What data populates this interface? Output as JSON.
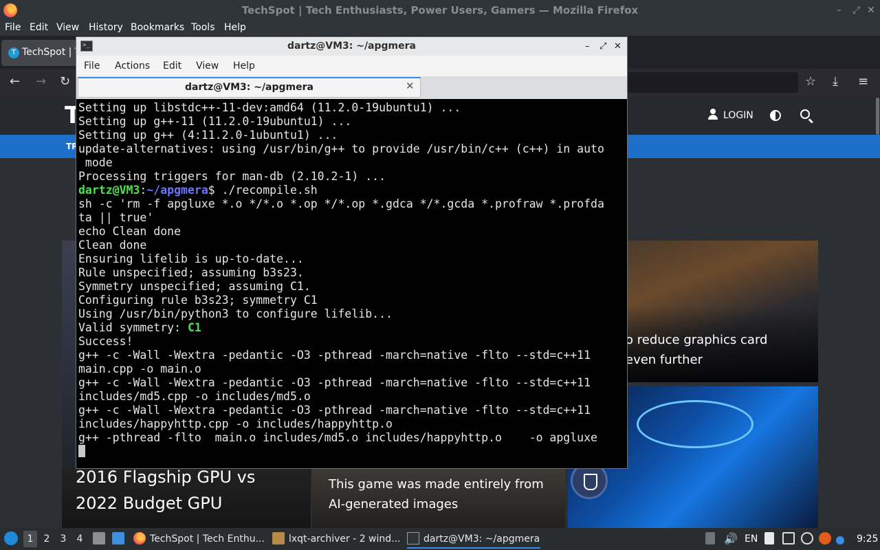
{
  "firefox": {
    "window_title": "TechSpot | Tech Enthusiasts, Power Users, Gamers — Mozilla Firefox",
    "menu": [
      {
        "label": "File"
      },
      {
        "label": "Edit"
      },
      {
        "label": "View"
      },
      {
        "label": "History"
      },
      {
        "label": "Bookmarks"
      },
      {
        "label": "Tools"
      },
      {
        "label": "Help"
      }
    ],
    "tab_label": "TechSpot | T",
    "tab_favicon": "T"
  },
  "website": {
    "logo": "T",
    "login": "LOGIN",
    "nav_first": "TR",
    "cards": {
      "right_top_title": "o reduce graphics card\neven further",
      "mid_bottom_title": "This game was made entirely from\nAI-generated images",
      "left_bottom_title": "2016 Flagship GPU vs\n2022 Budget GPU"
    }
  },
  "terminal": {
    "title": "dartz@VM3: ~/apgmera",
    "tab_title": "dartz@VM3: ~/apgmera",
    "app_icon_text": ">_",
    "menu": [
      {
        "label": "File"
      },
      {
        "label": "Actions"
      },
      {
        "label": "Edit"
      },
      {
        "label": "View"
      },
      {
        "label": "Help"
      }
    ],
    "prompt_user": "dartz@VM3",
    "prompt_path": "~/apgmera",
    "prompt_sep": ":",
    "prompt_cmd": "$ ./recompile.sh",
    "lines_before": [
      "Setting up libstdc++-11-dev:amd64 (11.2.0-19ubuntu1) ...",
      "Setting up g++-11 (11.2.0-19ubuntu1) ...",
      "Setting up g++ (4:11.2.0-1ubuntu1) ...",
      "update-alternatives: using /usr/bin/g++ to provide /usr/bin/c++ (c++) in auto",
      " mode",
      "Processing triggers for man-db (2.10.2-1) ..."
    ],
    "lines_mid": [
      "sh -c 'rm -f apgluxe *.o */*.o *.op */*.op *.gdca */*.gcda *.profraw *.profda",
      "ta || true'",
      "echo Clean done",
      "Clean done",
      "Ensuring lifelib is up-to-date...",
      "Rule unspecified; assuming b3s23.",
      "Symmetry unspecified; assuming C1.",
      "Configuring rule b3s23; symmetry C1",
      "Using /usr/bin/python3 to configure lifelib..."
    ],
    "valid_symmetry_label": "Valid symmetry: ",
    "valid_symmetry_value": "C1",
    "lines_after": [
      "Success!",
      "g++ -c -Wall -Wextra -pedantic -O3 -pthread -march=native -flto --std=c++11",
      "main.cpp -o main.o",
      "g++ -c -Wall -Wextra -pedantic -O3 -pthread -march=native -flto --std=c++11",
      "includes/md5.cpp -o includes/md5.o",
      "g++ -c -Wall -Wextra -pedantic -O3 -pthread -march=native -flto --std=c++11",
      "includes/happyhttp.cpp -o includes/happyhttp.o",
      "g++ -pthread -flto  main.o includes/md5.o includes/happyhttp.o    -o apgluxe"
    ]
  },
  "taskbar": {
    "workspaces": [
      "1",
      "2",
      "3",
      "4"
    ],
    "tasks": [
      {
        "label": "TechSpot | Tech Enthu..."
      },
      {
        "label": "lxqt-archiver - 2 wind..."
      },
      {
        "label": "dartz@VM3: ~/apgmera"
      }
    ],
    "lang": "EN",
    "clock": "9:25"
  }
}
